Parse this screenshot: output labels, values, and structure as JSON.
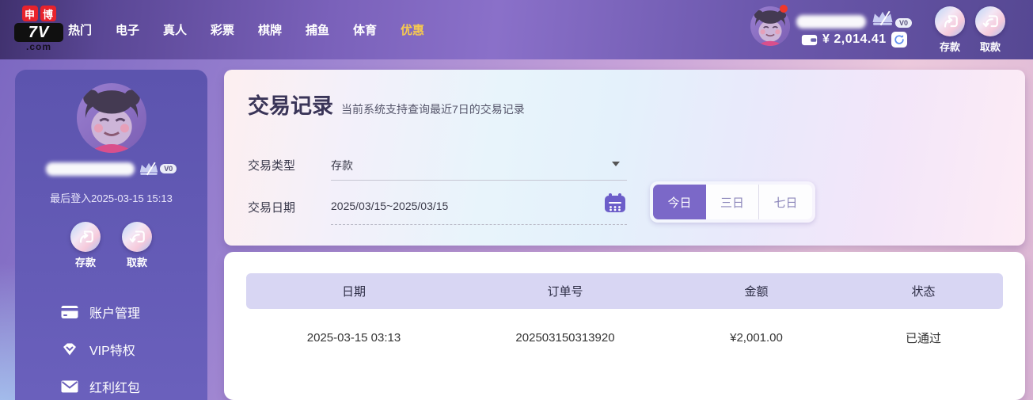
{
  "topbar": {
    "logo": {
      "sq1": "申",
      "sq2": "博",
      "main": "7V",
      "suffix": ".com"
    },
    "nav": [
      {
        "label": "热门"
      },
      {
        "label": "电子"
      },
      {
        "label": "真人"
      },
      {
        "label": "彩票"
      },
      {
        "label": "棋牌"
      },
      {
        "label": "捕鱼"
      },
      {
        "label": "体育"
      },
      {
        "label": "优惠"
      }
    ],
    "user": {
      "vip_level": "V0",
      "balance": "¥ 2,014.41"
    },
    "deposit_label": "存款",
    "withdraw_label": "取款"
  },
  "sidebar": {
    "vip_level": "V0",
    "last_login": "最后登入2025-03-15 15:13",
    "deposit_label": "存款",
    "withdraw_label": "取款",
    "menu": [
      {
        "icon": "card-icon",
        "label": "账户管理"
      },
      {
        "icon": "vip-gem-icon",
        "label": "VIP特权"
      },
      {
        "icon": "envelope-icon",
        "label": "红利红包"
      }
    ]
  },
  "main": {
    "title": "交易记录",
    "subtitle": "当前系统支持查询最近7日的交易记录",
    "filters": {
      "type_label": "交易类型",
      "type_value": "存款",
      "date_label": "交易日期",
      "date_value": "2025/03/15~2025/03/15"
    },
    "range_buttons": [
      {
        "label": "今日",
        "active": true
      },
      {
        "label": "三日",
        "active": false
      },
      {
        "label": "七日",
        "active": false
      }
    ],
    "table": {
      "headers": [
        "日期",
        "订单号",
        "金额",
        "状态"
      ],
      "rows": [
        [
          "2025-03-15 03:13",
          "202503150313920",
          "¥2,001.00",
          "已通过"
        ]
      ]
    }
  },
  "colors": {
    "accent_purple": "#7b68c8",
    "nav_highlight": "#f6c94f",
    "table_header_bg": "#d8d6f3",
    "calendar_icon": "#6c5ec9",
    "logo_red": "#e8232c",
    "notification_dot": "#f0382b"
  }
}
